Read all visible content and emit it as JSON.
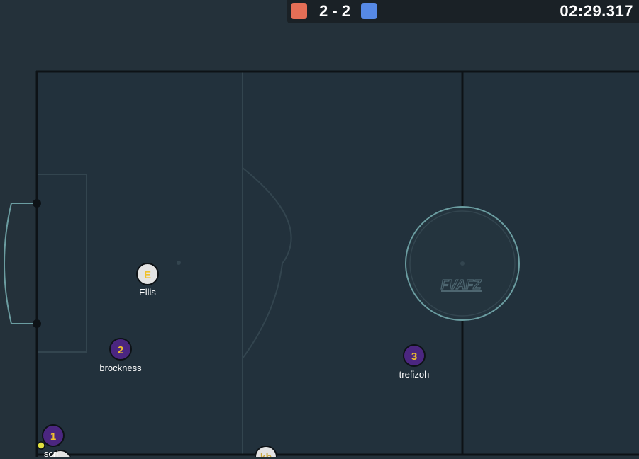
{
  "scoreboard": {
    "red_score": 2,
    "blue_score": 2,
    "separator": "-",
    "score_text": "2 - 2",
    "clock": "02:29.317",
    "red_color": "#e56e56",
    "blue_color": "#5689e5"
  },
  "colors": {
    "background": "#24313a",
    "pitch": "#22313c",
    "line": "#0d1216",
    "marking": "#33454f",
    "circle": "#6b9da1",
    "team_purple": "#4b2680",
    "team_white": "#e3e3e3",
    "number_gold": "#f0c12c"
  },
  "field": {
    "logo_text": "FVAFZ"
  },
  "players": [
    {
      "id": "ellis",
      "avatar": "E",
      "name": "Ellis",
      "team": "white"
    },
    {
      "id": "brockness",
      "avatar": "2",
      "name": "brockness",
      "team": "purple"
    },
    {
      "id": "trefizoh",
      "avatar": "3",
      "name": "trefizoh",
      "team": "purple"
    },
    {
      "id": "scri",
      "avatar": "1",
      "name": "scri",
      "team": "purple"
    },
    {
      "id": "kb",
      "avatar": "kb",
      "name": "",
      "team": "white"
    },
    {
      "id": "unnamed-white",
      "avatar": "",
      "name": "",
      "team": "white"
    }
  ],
  "ball": {
    "color": "#e0e040"
  }
}
